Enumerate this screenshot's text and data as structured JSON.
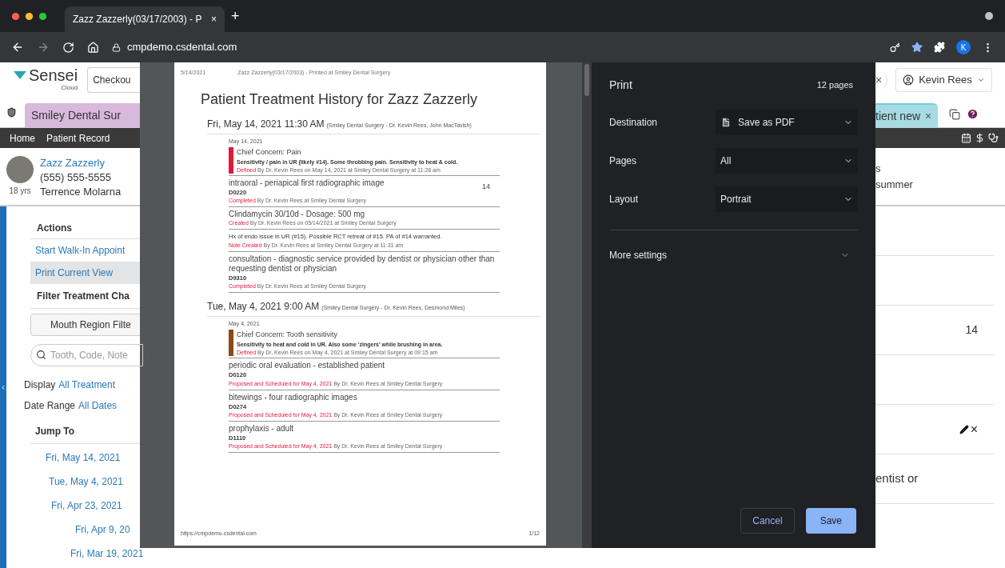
{
  "browser": {
    "tab_title": "Zazz Zazzerly(03/17/2003) - P",
    "tab_close": "×",
    "new_tab": "+",
    "url": "cmpdemo.csdental.com",
    "profile": "K"
  },
  "app": {
    "logo": "Sensei",
    "logo_sub": "Cloud",
    "checkout": "Checkou",
    "search_close": "×",
    "user": "Kevin Rees",
    "tabs": [
      {
        "label": "Smiley Dental Sur",
        "selected": false,
        "color": "#d8b9dc"
      },
      {
        "label": "tient new",
        "close": "×",
        "selected": true,
        "color": "#a6dbe4"
      }
    ],
    "nav": [
      "Home",
      "Patient Record"
    ],
    "patient": {
      "name": "Zazz Zazzerly",
      "phone": "(555) 555-5555",
      "age": "18 yrs",
      "provider": "Terrence Molarna"
    },
    "header_right": [
      "s",
      "summer"
    ],
    "sidebar": {
      "actions_title": "Actions",
      "actions": [
        {
          "label": "Start Walk-In Appoint",
          "selected": false
        },
        {
          "label": "Print Current View",
          "selected": true
        }
      ],
      "filter_title": "Filter Treatment Cha",
      "region_button": "Mouth Region Filte",
      "search_placeholder": "Tooth, Code, Note",
      "display_label": "Display",
      "display_value": "All Treatment",
      "range_label": "Date Range",
      "range_value": "All Dates",
      "jump_title": "Jump To",
      "jump": [
        "Fri, May 14, 2021",
        "Tue, May 4, 2021",
        "Fri, Apr 23, 2021",
        "Fri, Apr 9, 20",
        "Fri, Mar 19, 2021"
      ]
    },
    "right_rows": [
      {
        "kind": "blank"
      },
      {
        "kind": "blank"
      },
      {
        "kind": "tooth",
        "text": "14"
      },
      {
        "kind": "blank"
      },
      {
        "kind": "actions",
        "close": "×"
      },
      {
        "kind": "text",
        "text": "entist or"
      }
    ]
  },
  "print": {
    "title": "Print",
    "pages": "12 pages",
    "settings": [
      {
        "label": "Destination",
        "value": "Save as PDF",
        "kind": "file"
      },
      {
        "label": "Pages",
        "value": "All",
        "kind": "plain"
      },
      {
        "label": "Layout",
        "value": "Portrait",
        "kind": "plain"
      }
    ],
    "more": "More settings",
    "buttons": [
      {
        "label": "Cancel",
        "kind": "secondary"
      },
      {
        "label": "Save",
        "kind": "primary"
      }
    ]
  },
  "preview": {
    "date": "5/14/2021",
    "header": "Zazz Zazzerly(03/17/2003) - Printed at Smiley Dental Surgery",
    "title": "Patient Treatment History for Zazz Zazzerly",
    "footer_url": "https://cmpdemo.csdental.com",
    "footer_page": "1/12",
    "sections": [
      {
        "heading": "Fri, May 14, 2021 11:30 AM",
        "detail": "(Smiley Dental Surgery - Dr. Kevin Rees, John MacTavish)",
        "date": "May 14, 2021",
        "concern": {
          "title": "Chief Concern: Pain",
          "text": "Sensitivity / pain in UR (likely #14). Some throbbing pain. Sensitivity to heat & cold.",
          "status": "Defined",
          "meta": "By Dr. Kevin Rees on May 14, 2021 at Smiley Dental Surgery at 11:28 am",
          "color": "#e0183c"
        },
        "items": [
          {
            "kind": "procedure",
            "title": "intraoral - periapical first radiographic image",
            "code": "D0220",
            "tooth": "14",
            "status": "Completed",
            "meta": "By Dr. Kevin Rees at Smiley Dental Surgery"
          },
          {
            "kind": "procedure",
            "title": "Clindamycin 30/10d - Dosage: 500 mg",
            "status": "Created",
            "meta": "By Dr. Kevin Rees on 05/14/2021 at Smiley Dental Surgery"
          },
          {
            "kind": "note",
            "title": "Hx of endo issue in UR (#15). Possible RCT retreat of #15. PA of #14 warranted.",
            "status": "Note Created",
            "meta": "By Dr. Kevin Rees at Smiley Dental Surgery at 11:31 am"
          },
          {
            "kind": "procedure",
            "title": "consultation - diagnostic service provided by dentist or physician other than requesting dentist or physician",
            "code": "D9310",
            "status": "Completed",
            "meta": "By Dr. Kevin Rees at Smiley Dental Surgery"
          }
        ]
      },
      {
        "heading": "Tue, May 4, 2021 9:00 AM",
        "detail": "(Smiley Dental Surgery - Dr. Kevin Rees, Desmond Miles)",
        "date": "May 4, 2021",
        "concern": {
          "title": "Chief Concern: Tooth sensitivity",
          "text": "Sensitivity to heat and cold in UR. Also some 'zingers' while brushing in area.",
          "status": "Defined",
          "meta": "By Dr. Kevin Rees on May 4, 2021 at Smiley Dental Surgery at 09:15 am",
          "color": "#8b4a14"
        },
        "items": [
          {
            "kind": "procedure",
            "title": "periodic oral evaluation - established patient",
            "code": "D0120",
            "status": "Proposed and Scheduled for May 4, 2021",
            "meta": "By Dr. Kevin Rees at Smiley Dental Surgery"
          },
          {
            "kind": "procedure",
            "title": "bitewings - four radiographic images",
            "code": "D0274",
            "status": "Proposed and Scheduled for May 4, 2021",
            "meta": "By Dr. Kevin Rees at Smiley Dental Surgery"
          },
          {
            "kind": "procedure",
            "title": "prophylaxis - adult",
            "code": "D1110",
            "status": "Proposed and Scheduled for May 4, 2021",
            "meta": "By Dr. Kevin Rees at Smiley Dental Surgery"
          }
        ]
      }
    ]
  }
}
